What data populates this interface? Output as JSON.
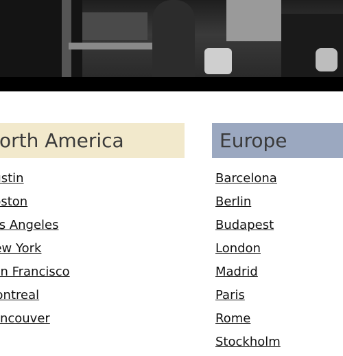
{
  "regions": [
    {
      "name": "North America",
      "cities": [
        "Austin",
        "Boston",
        "Los Angeles",
        "New York",
        "San Francisco",
        "Montreal",
        "Vancouver"
      ]
    },
    {
      "name": "Europe",
      "cities": [
        "Barcelona",
        "Berlin",
        "Budapest",
        "London",
        "Madrid",
        "Paris",
        "Rome",
        "Stockholm"
      ]
    }
  ],
  "colors": {
    "north_america_header": "#f2e9cc",
    "europe_header": "#9ba8c0",
    "band": "#000000"
  }
}
